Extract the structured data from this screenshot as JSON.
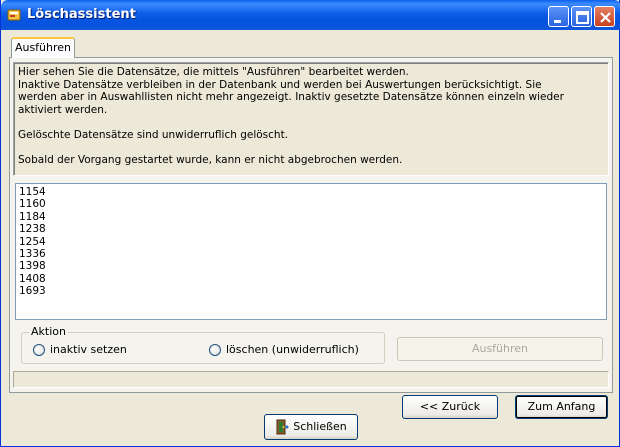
{
  "window": {
    "title": "Löschassistent"
  },
  "tab": {
    "label": "Ausführen"
  },
  "info": {
    "text": "Hier sehen Sie die Datensätze, die mittels \"Ausführen\" bearbeitet werden.\nInaktive Datensätze verbleiben in der Datenbank und werden bei Auswertungen berücksichtigt. Sie\nwerden aber in Auswahllisten nicht mehr angezeigt. Inaktiv gesetzte Datensätze können einzeln wieder aktiviert werden.\n\nGelöschte Datensätze sind unwiderruflich gelöscht.\n\nSobald der Vorgang gestartet wurde, kann er nicht abgebrochen werden."
  },
  "records": [
    "1154",
    "1160",
    "1184",
    "1238",
    "1254",
    "1336",
    "1398",
    "1408",
    "1693"
  ],
  "action_group": {
    "legend": "Aktion",
    "options": [
      "inaktiv setzen",
      "löschen (unwiderruflich)"
    ]
  },
  "buttons": {
    "execute": "Ausführen",
    "back": "<< Zurück",
    "start": "Zum Anfang",
    "close": "Schließen"
  }
}
